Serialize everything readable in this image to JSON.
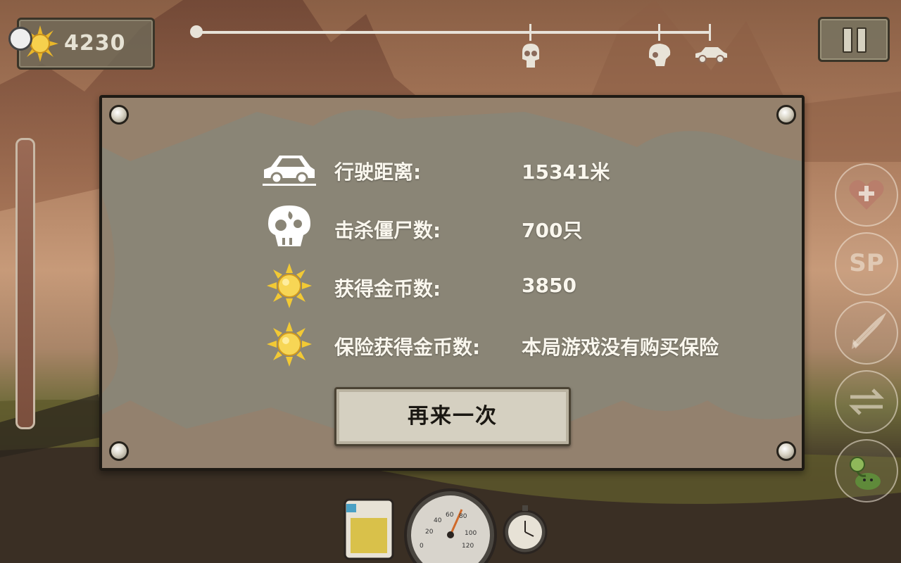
{
  "hud": {
    "coin_count": "4230",
    "colors": {
      "panel": "#8a8576",
      "text": "#faf7ee",
      "button": "#d5d0c1"
    }
  },
  "progress": {
    "markers": [
      "zombie-skull-icon",
      "zombie-skull-icon",
      "car-icon"
    ]
  },
  "results": {
    "rows": [
      {
        "icon": "car-icon",
        "label": "行驶距离:",
        "value": "15341米"
      },
      {
        "icon": "skull-icon",
        "label": "击杀僵尸数:",
        "value": "700只"
      },
      {
        "icon": "sun-coin-icon",
        "label": "获得金币数:",
        "value": "3850"
      },
      {
        "icon": "sun-coin-icon",
        "label": "保险获得金币数:",
        "value": "本局游戏没有购买保险"
      }
    ],
    "retry_label": "再来一次"
  },
  "side_buttons": [
    "heal-icon",
    "sp-icon",
    "rocket-icon",
    "swap-icon",
    "plant-icon"
  ],
  "side_labels": {
    "sp": "SP"
  },
  "gauge": {
    "ticks": [
      "0",
      "20",
      "40",
      "60",
      "80",
      "100",
      "120"
    ]
  }
}
